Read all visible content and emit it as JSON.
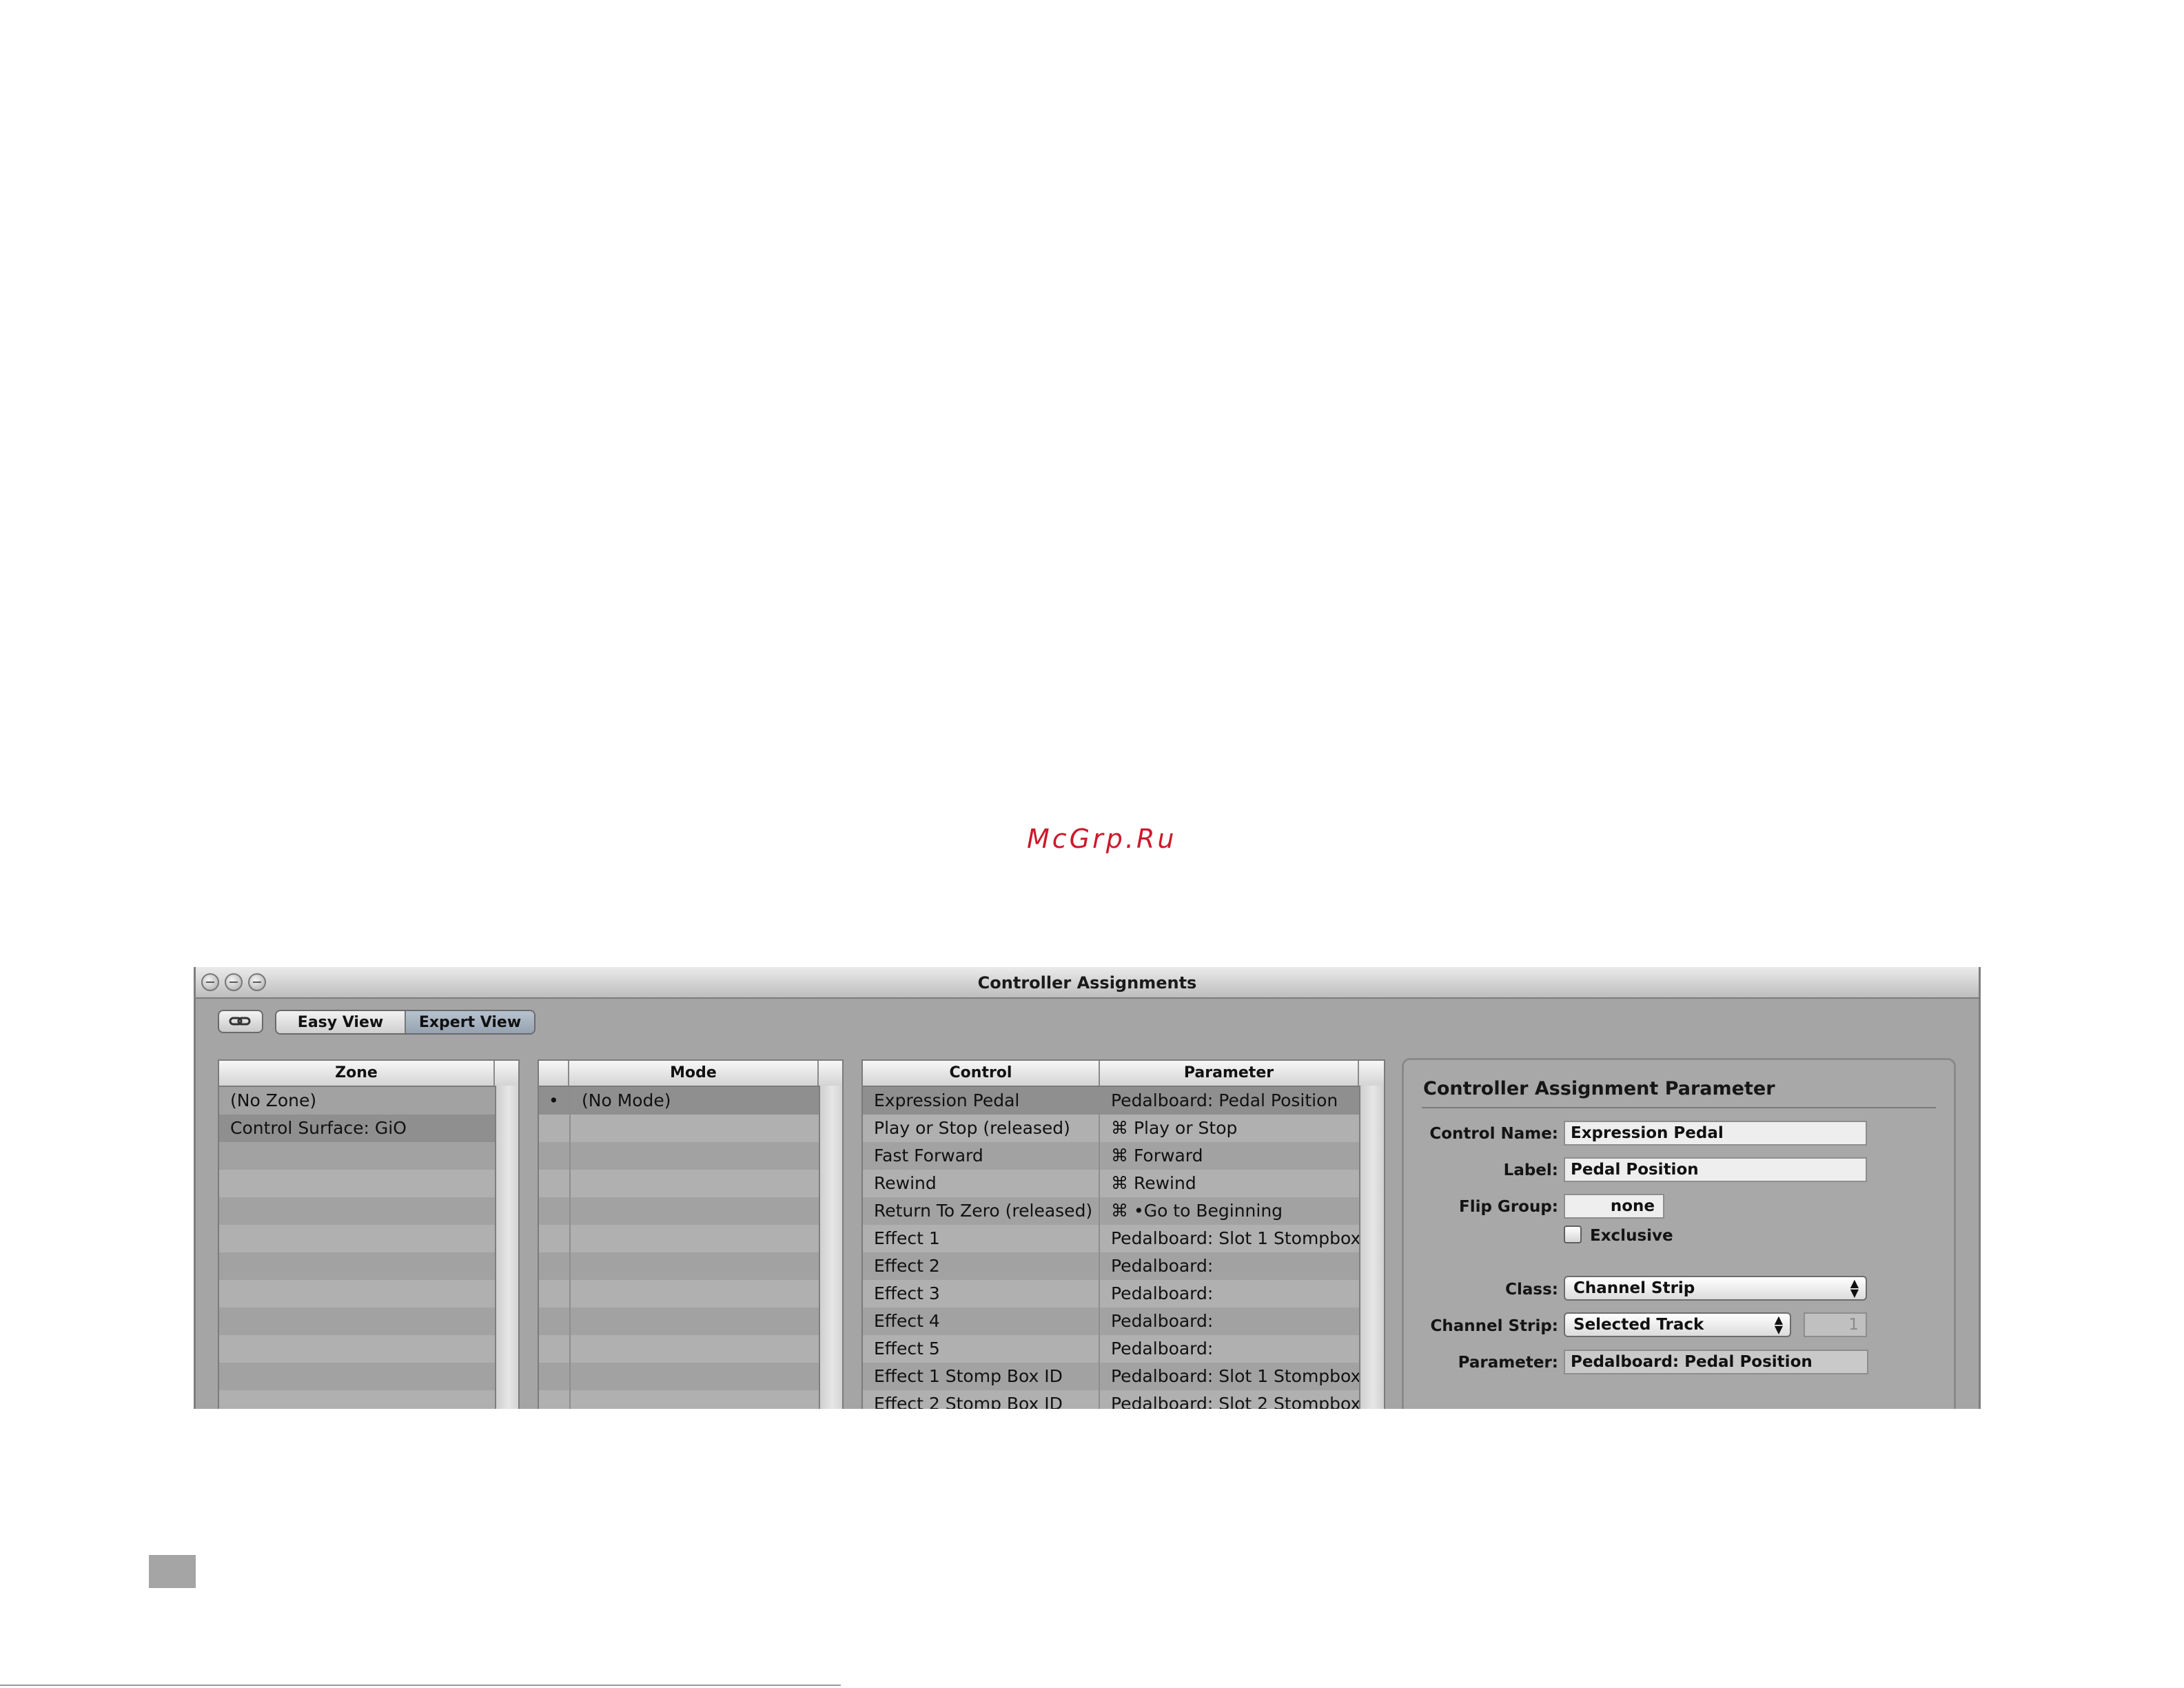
{
  "watermark": "McGrp.Ru",
  "window": {
    "title": "Controller Assignments",
    "view_buttons": {
      "easy": "Easy View",
      "expert": "Expert View",
      "selected": "Expert View"
    },
    "link_icon": "link-icon"
  },
  "zone_list": {
    "header": "Zone",
    "items": [
      "(No Zone)",
      "Control Surface: GiO"
    ],
    "selected": "Control Surface: GiO"
  },
  "mode_list": {
    "header": "Mode",
    "items": [
      {
        "bullet": "•",
        "label": "(No Mode)"
      }
    ]
  },
  "control_table": {
    "headers": {
      "control": "Control",
      "parameter": "Parameter"
    },
    "rows": [
      {
        "control": "Expression Pedal",
        "parameter": "Pedalboard: Pedal Position"
      },
      {
        "control": "Play or Stop (released)",
        "parameter": "⌘ Play or Stop"
      },
      {
        "control": "Fast Forward",
        "parameter": "⌘ Forward"
      },
      {
        "control": "Rewind",
        "parameter": "⌘ Rewind"
      },
      {
        "control": "Return To Zero (released)",
        "parameter": "⌘ •Go to Beginning"
      },
      {
        "control": "Effect 1",
        "parameter": "Pedalboard: Slot 1 Stompbox"
      },
      {
        "control": "Effect 2",
        "parameter": "Pedalboard:"
      },
      {
        "control": "Effect 3",
        "parameter": "Pedalboard:"
      },
      {
        "control": "Effect 4",
        "parameter": "Pedalboard:"
      },
      {
        "control": "Effect 5",
        "parameter": "Pedalboard:"
      },
      {
        "control": "Effect 1 Stomp Box ID",
        "parameter": "Pedalboard: Slot 1 Stompbox"
      },
      {
        "control": "Effect 2 Stomp Box ID",
        "parameter": "Pedalboard: Slot 2 Stompbox"
      }
    ]
  },
  "assignment": {
    "title": "Controller Assignment Parameter",
    "control_name_label": "Control Name:",
    "control_name_value": "Expression Pedal",
    "label_label": "Label:",
    "label_value": "Pedal Position",
    "flip_group_label": "Flip Group:",
    "flip_group_value": "none",
    "exclusive_label": "Exclusive",
    "exclusive_checked": false,
    "class_label": "Class:",
    "class_value": "Channel Strip",
    "channel_strip_label": "Channel Strip:",
    "channel_strip_value": "Selected Track",
    "channel_number": "1",
    "parameter_label": "Parameter:",
    "parameter_value": "Pedalboard: Pedal Position"
  }
}
